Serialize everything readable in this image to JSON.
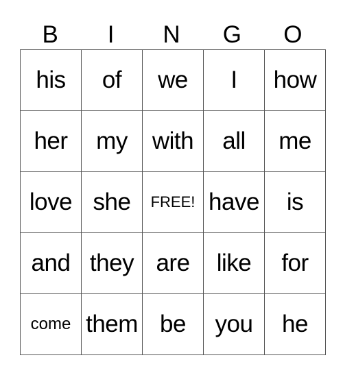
{
  "header": [
    "B",
    "I",
    "N",
    "G",
    "O"
  ],
  "rows": [
    [
      "his",
      "of",
      "we",
      "I",
      "how"
    ],
    [
      "her",
      "my",
      "with",
      "all",
      "me"
    ],
    [
      "love",
      "she",
      "FREE!",
      "have",
      "is"
    ],
    [
      "and",
      "they",
      "are",
      "like",
      "for"
    ],
    [
      "come",
      "them",
      "be",
      "you",
      "he"
    ]
  ]
}
